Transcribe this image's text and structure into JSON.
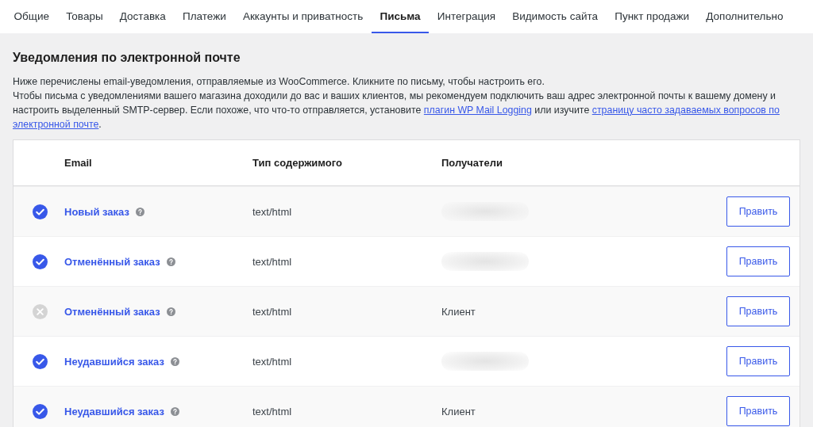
{
  "tabs": [
    {
      "label": "Общие",
      "selected": false
    },
    {
      "label": "Товары",
      "selected": false
    },
    {
      "label": "Доставка",
      "selected": false
    },
    {
      "label": "Платежи",
      "selected": false
    },
    {
      "label": "Аккаунты и приватность",
      "selected": false
    },
    {
      "label": "Письма",
      "selected": true
    },
    {
      "label": "Интеграция",
      "selected": false
    },
    {
      "label": "Видимость сайта",
      "selected": false
    },
    {
      "label": "Пункт продажи",
      "selected": false
    },
    {
      "label": "Дополнительно",
      "selected": false
    }
  ],
  "section": {
    "title": "Уведомления по электронной почте",
    "intro": "Ниже перечислены email-уведомления, отправляемые из WooCommerce. Кликните по письму, чтобы настроить его.",
    "note": [
      {
        "kind": "text",
        "text": "Чтобы письма с уведомлениями вашего магазина доходили до вас и ваших клиентов, мы рекомендуем подключить ваш адрес электронной почты к вашему домену и настроить выделенный SMTP-сервер. Если похоже, что что-то отправляется, установите "
      },
      {
        "kind": "link",
        "text": "плагин WP Mail Logging"
      },
      {
        "kind": "text",
        "text": " или изучите "
      },
      {
        "kind": "link",
        "text": "страницу часто задаваемых вопросов по"
      },
      {
        "kind": "link",
        "text": "электронной почте"
      },
      {
        "kind": "text",
        "text": "."
      }
    ]
  },
  "table": {
    "columns": [
      "Email",
      "Тип содержимого",
      "Получатели"
    ],
    "rows": [
      {
        "enabled": true,
        "email": "Новый заказ",
        "content_type": "text/html",
        "recipient_redacted": true,
        "action": "Править"
      },
      {
        "enabled": true,
        "email": "Отменённый заказ",
        "content_type": "text/html",
        "recipient_redacted": true,
        "action": "Править"
      },
      {
        "enabled": false,
        "email": "Отменённый заказ",
        "content_type": "text/html",
        "recipients": "Клиент",
        "action": "Править"
      },
      {
        "enabled": true,
        "email": "Неудавшийся заказ",
        "content_type": "text/html",
        "recipient_redacted": true,
        "action": "Править"
      },
      {
        "enabled": true,
        "email": "Неудавшийся заказ",
        "content_type": "text/html",
        "recipients": "Клиент",
        "action": "Править"
      }
    ]
  }
}
